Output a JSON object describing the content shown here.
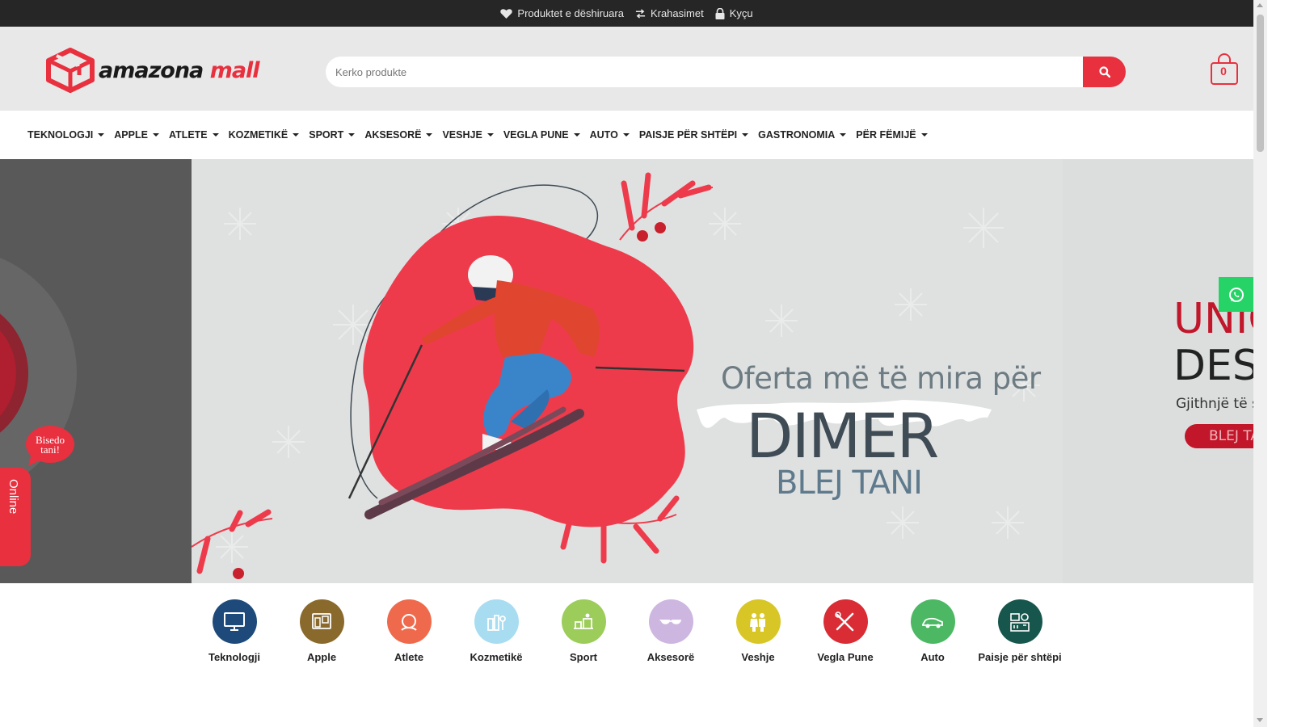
{
  "topbar": {
    "wishlist_label": "Produktet e dëshiruara",
    "compare_label": "Krahasimet",
    "login_label": "Kyçu"
  },
  "header": {
    "logo_primary": "amazona",
    "logo_secondary": "mall",
    "search_placeholder": "Kerko produkte",
    "cart_count": "0"
  },
  "nav": {
    "items": [
      {
        "label": "TEKNOLOGJI"
      },
      {
        "label": "APPLE"
      },
      {
        "label": "ATLETE"
      },
      {
        "label": "KOZMETIKË"
      },
      {
        "label": "SPORT"
      },
      {
        "label": "AKSESORË"
      },
      {
        "label": "VESHJE"
      },
      {
        "label": "VEGLA PUNE"
      },
      {
        "label": "AUTO"
      },
      {
        "label": "PAISJE PËR SHTËPI"
      },
      {
        "label": "GASTRONOMIA"
      },
      {
        "label": "PËR FËMIJË"
      }
    ]
  },
  "hero": {
    "headline": "Oferta më të mira për",
    "title": "DIMER",
    "cta": "BLEJ TANI",
    "next_slide": {
      "line1": "UNIQ",
      "line2": "DES",
      "line3": "Gjithnjë të s",
      "button": "BLEJ TA"
    }
  },
  "chat": {
    "bubble": "Bisedo tani!",
    "tab": "Online"
  },
  "categories": [
    {
      "label": "Teknologji",
      "color": "#1d4a7a",
      "icon": "monitor-icon"
    },
    {
      "label": "Apple",
      "color": "#8a6a2c",
      "icon": "devices-icon"
    },
    {
      "label": "Atlete",
      "color": "#ef6a4c",
      "icon": "shoe-icon"
    },
    {
      "label": "Kozmetikë",
      "color": "#a8dcf0",
      "icon": "cosmetics-icon"
    },
    {
      "label": "Sport",
      "color": "#9ccc5a",
      "icon": "sport-icon"
    },
    {
      "label": "Aksesorë",
      "color": "#cdb6df",
      "icon": "sunglasses-icon"
    },
    {
      "label": "Veshje",
      "color": "#d8c626",
      "icon": "clothes-icon"
    },
    {
      "label": "Vegla Pune",
      "color": "#d92c35",
      "icon": "tools-icon"
    },
    {
      "label": "Auto",
      "color": "#4cb864",
      "icon": "car-icon"
    },
    {
      "label": "Paisje për shtëpi",
      "color": "#17564c",
      "icon": "appliance-icon"
    }
  ],
  "colors": {
    "brand": "#e8303f",
    "topbar": "#262626",
    "whatsapp": "#25d366"
  }
}
